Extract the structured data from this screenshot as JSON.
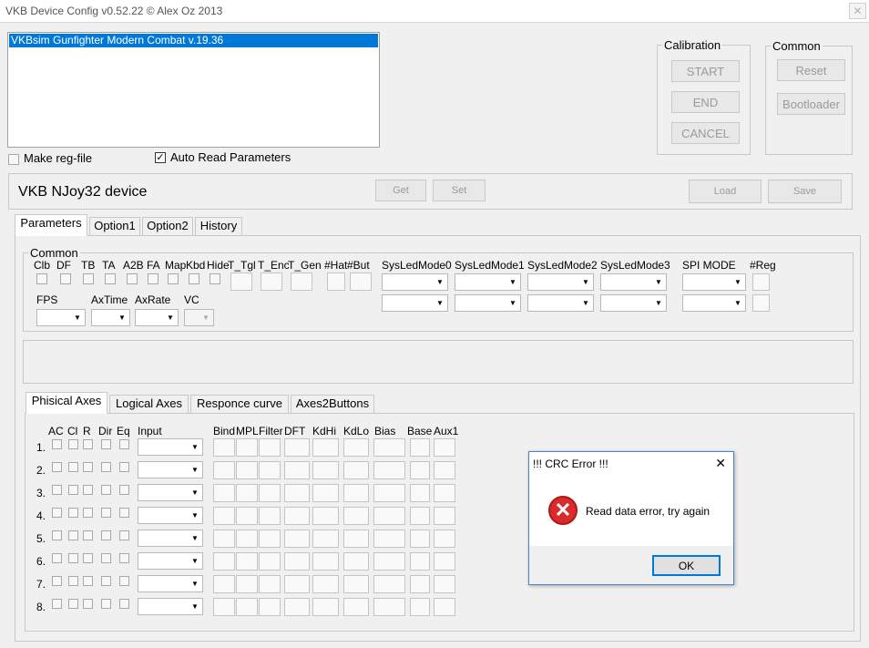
{
  "window": {
    "title": "VKB Device Config  v0.52.22 © Alex Oz 2013",
    "close_glyph": "✕"
  },
  "device_list": {
    "items": [
      "VKBsim Gunfighter Modern Combat  v.19.36"
    ]
  },
  "checkboxes": {
    "make_reg_file": "Make reg-file",
    "auto_read_parameters": "Auto Read Parameters",
    "check_glyph": "✓"
  },
  "calibration": {
    "label": "Calibration",
    "start": "START",
    "end": "END",
    "cancel": "CANCEL"
  },
  "common_group": {
    "label": "Common",
    "reset": "Reset",
    "bootloader": "Bootloader"
  },
  "device_bar": {
    "name": "VKB NJoy32 device",
    "get": "Get",
    "set": "Set",
    "load": "Load",
    "save": "Save"
  },
  "tabs": [
    "Parameters",
    "Option1",
    "Option2",
    "History"
  ],
  "parameters": {
    "common_label": "Common",
    "flags": [
      "Clb",
      "DF",
      "TB",
      "TA",
      "A2B",
      "FA",
      "Map",
      "Kbd",
      "Hide"
    ],
    "fields": [
      "T_Tgl",
      "T_Enc",
      "T_Gen",
      "#Hat",
      "#But"
    ],
    "sysled": [
      "SysLedMode0",
      "SysLedMode1",
      "SysLedMode2",
      "SysLedMode3"
    ],
    "spi_mode": "SPI MODE",
    "reg": "#Reg",
    "fps": "FPS",
    "axtime": "AxTime",
    "axrate": "AxRate",
    "vc": "VC"
  },
  "axes_tabs": [
    "Phisical Axes",
    "Logical Axes",
    "Responce curve",
    "Axes2Buttons"
  ],
  "axes": {
    "check_headers": [
      "AC",
      "Cl",
      "R",
      "Dir",
      "Eq"
    ],
    "input": "Input",
    "field_headers": [
      "Bind",
      "MPL",
      "Filter",
      "DFT",
      "KdHi",
      "KdLo",
      "Bias",
      "Base",
      "Aux1"
    ],
    "rows": [
      "1.",
      "2.",
      "3.",
      "4.",
      "5.",
      "6.",
      "7.",
      "8."
    ]
  },
  "dialog": {
    "title": "!!! CRC Error !!!",
    "message": "Read data error, try again",
    "ok": "OK",
    "close_glyph": "✕",
    "icon_glyph": "✕"
  },
  "dropdown_arrow": "▼",
  "colors": {
    "selection": "#0078d7",
    "dialog_border": "#4a84c7",
    "error_icon": "#d92b2b"
  }
}
